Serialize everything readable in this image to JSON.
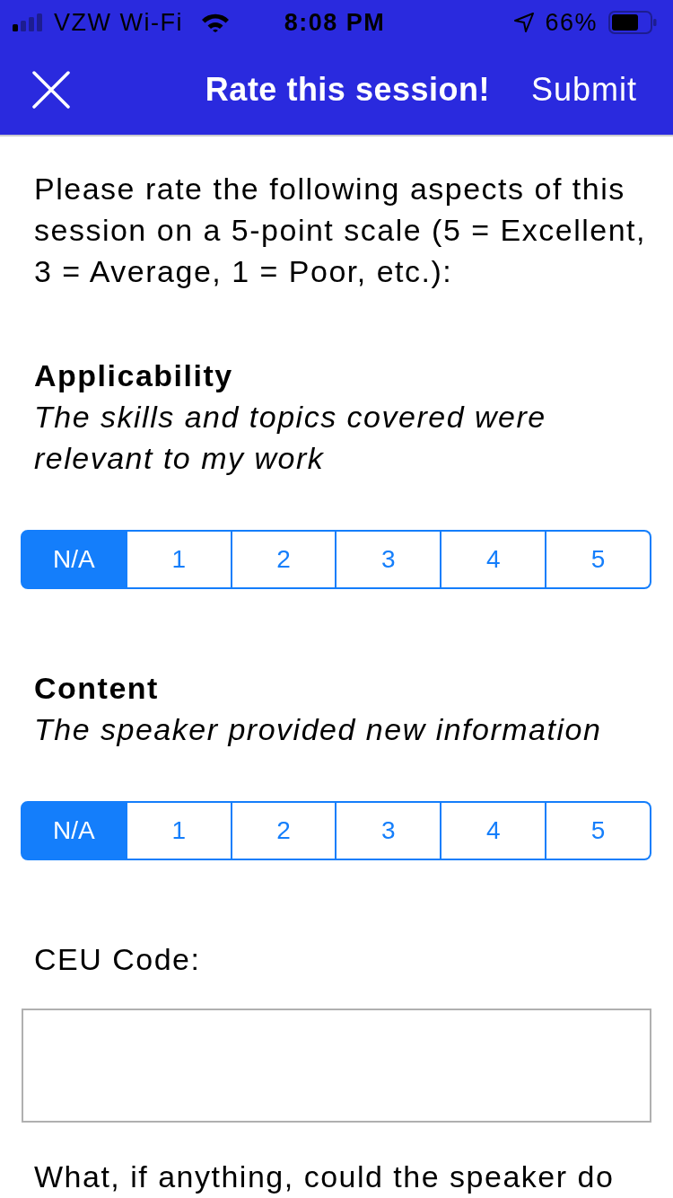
{
  "status_bar": {
    "carrier": "VZW Wi-Fi",
    "time": "8:08 PM",
    "battery": "66%"
  },
  "nav_bar": {
    "title": "Rate this session!",
    "action": "Submit"
  },
  "intro": "Please rate the following aspects of this session on a 5-point scale (5 = Excellent, 3 = Average, 1 = Poor, etc.):",
  "questions": [
    {
      "title": "Applicability",
      "description": "The skills and topics covered were relevant to my work",
      "options": [
        {
          "label": "N/A",
          "selected": true
        },
        {
          "label": "1",
          "selected": false
        },
        {
          "label": "2",
          "selected": false
        },
        {
          "label": "3",
          "selected": false
        },
        {
          "label": "4",
          "selected": false
        },
        {
          "label": "5",
          "selected": false
        }
      ]
    },
    {
      "title": "Content",
      "description": "The speaker provided new information",
      "options": [
        {
          "label": "N/A",
          "selected": true
        },
        {
          "label": "1",
          "selected": false
        },
        {
          "label": "2",
          "selected": false
        },
        {
          "label": "3",
          "selected": false
        },
        {
          "label": "4",
          "selected": false
        },
        {
          "label": "5",
          "selected": false
        }
      ]
    }
  ],
  "ceu": {
    "label": "CEU Code:"
  },
  "next_question": "What, if anything, could the speaker do"
}
